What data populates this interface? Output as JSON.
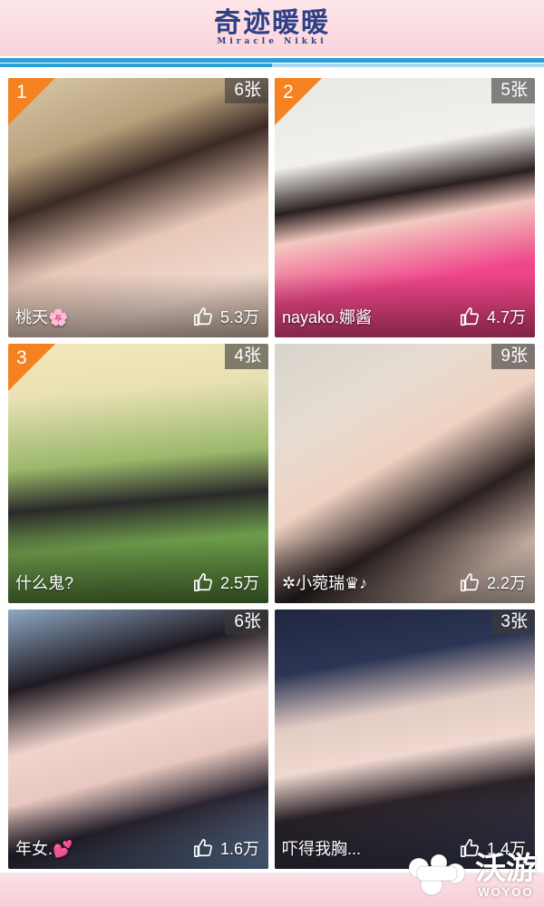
{
  "header": {
    "logo_title": "奇迹暖暖",
    "logo_subtitle": "Miracle Nikki",
    "brand_color": "#2f3f88",
    "accent_blue": "#2a9fd8"
  },
  "cards": [
    {
      "rank": "1",
      "count": "6张",
      "name": "桃天🌸",
      "likes": "5.3万"
    },
    {
      "rank": "2",
      "count": "5张",
      "name": "nayako.娜酱",
      "likes": "4.7万"
    },
    {
      "rank": "3",
      "count": "4张",
      "name": "什么鬼?",
      "likes": "2.5万"
    },
    {
      "rank": "",
      "count": "9张",
      "name": "✲小菀瑞♛♪",
      "likes": "2.2万"
    },
    {
      "rank": "",
      "count": "6张",
      "name": "年女.💕",
      "likes": "1.6万"
    },
    {
      "rank": "",
      "count": "3张",
      "name": "吓得我胸...",
      "likes": "1.4万"
    }
  ],
  "watermark": {
    "cn": "沃游",
    "en": "WOYOO"
  },
  "colors": {
    "rank_badge": "#f58220",
    "header_pink": "#fde6ea"
  }
}
